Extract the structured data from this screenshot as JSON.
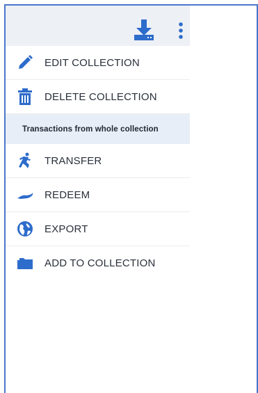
{
  "toolbar": {
    "download_icon": "download-icon",
    "more_icon": "more-vertical-icon",
    "accent_color": "#2d6ccb"
  },
  "menu": {
    "items_top": [
      {
        "label": "EDIT COLLECTION",
        "icon": "pencil-icon"
      },
      {
        "label": "DELETE COLLECTION",
        "icon": "trash-icon"
      }
    ],
    "section_title": "Transactions from whole collection",
    "items_bottom": [
      {
        "label": "TRANSFER",
        "icon": "runner-icon"
      },
      {
        "label": "REDEEM",
        "icon": "hand-give-icon"
      },
      {
        "label": "EXPORT",
        "icon": "globe-icon"
      },
      {
        "label": "ADD TO COLLECTION",
        "icon": "folder-icon"
      }
    ]
  },
  "colors": {
    "frame": "#4a76c9",
    "header_band": "#edf0f5",
    "section_band": "#e8eef7",
    "icon": "#2d6ccb",
    "text": "#2a2f3a"
  }
}
